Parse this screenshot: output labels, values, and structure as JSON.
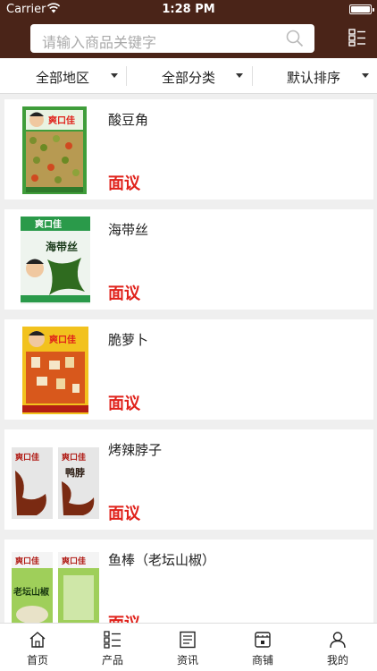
{
  "status_bar": {
    "carrier": "Carrier",
    "time": "1:28 PM"
  },
  "search": {
    "placeholder": "请输入商品关键字"
  },
  "filters": [
    {
      "label": "全部地区"
    },
    {
      "label": "全部分类"
    },
    {
      "label": "默认排序"
    }
  ],
  "products": [
    {
      "name": "酸豆角",
      "price": "面议",
      "brand": "爽口佳"
    },
    {
      "name": "海带丝",
      "price": "面议",
      "brand": "爽口佳",
      "sub": "海带丝"
    },
    {
      "name": "脆萝卜",
      "price": "面议",
      "brand": "爽口佳"
    },
    {
      "name": "烤辣脖子",
      "price": "面议",
      "brand": "爽口佳",
      "sub": "鸭脖"
    },
    {
      "name": "鱼棒（老坛山椒）",
      "price": "面议",
      "brand": "爽口佳",
      "sub": "老坛山椒"
    }
  ],
  "tabs": [
    {
      "label": "首页",
      "icon": "home-icon"
    },
    {
      "label": "产品",
      "icon": "list-icon"
    },
    {
      "label": "资讯",
      "icon": "news-icon"
    },
    {
      "label": "商铺",
      "icon": "store-icon"
    },
    {
      "label": "我的",
      "icon": "user-icon"
    }
  ]
}
